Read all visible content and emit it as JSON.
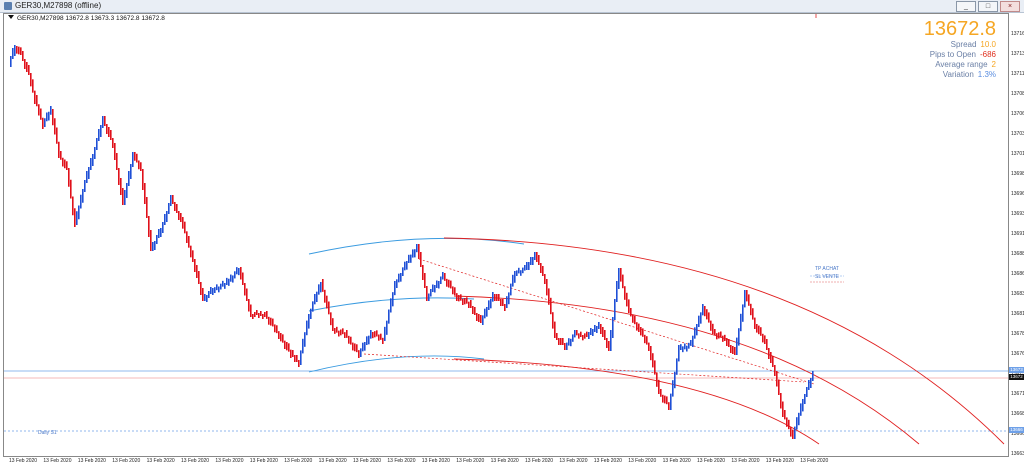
{
  "window": {
    "title": "GER30,M27898 (offline)",
    "buttons": {
      "minimize": "_",
      "maximize": "□",
      "close": "×"
    }
  },
  "chart": {
    "ohlc_header": "GER30,M27898  13672.8 13673.3 13672.8 13672.8"
  },
  "info_panel": {
    "price": "13672.8",
    "price_color": "#f5a623",
    "rows": [
      {
        "label": "Spread",
        "value": "10.0",
        "color": "#f5a623"
      },
      {
        "label": "Pips to Open",
        "value": "-686",
        "color": "#e0301e"
      },
      {
        "label": "Average range",
        "value": "2",
        "color": "#f5a623"
      },
      {
        "label": "Variation",
        "value": "1.3%",
        "color": "#5a8de0"
      }
    ]
  },
  "price_axis": {
    "ticks": [
      "13716",
      "13713",
      "13711",
      "13708",
      "13706",
      "13703",
      "13701",
      "13698",
      "13696",
      "13693",
      "13691",
      "13688",
      "13686",
      "13683",
      "13681",
      "13678",
      "13676",
      "13673",
      "13671",
      "13668",
      "13666",
      "13663"
    ],
    "tags": [
      {
        "value": "13673",
        "color": "#6ea0e8"
      },
      {
        "value": "13672",
        "color": "#111111"
      },
      {
        "value": "13666",
        "color": "#6ea0e8"
      }
    ]
  },
  "time_axis": {
    "labels": [
      "13 Feb 2020",
      "13 Feb 2020",
      "13 Feb 2020",
      "13 Feb 2020",
      "13 Feb 2020",
      "13 Feb 2020",
      "13 Feb 2020",
      "13 Feb 2020",
      "13 Feb 2020",
      "13 Feb 2020",
      "13 Feb 2020",
      "13 Feb 2020",
      "13 Feb 2020",
      "13 Feb 2020",
      "13 Feb 2020",
      "13 Feb 2020",
      "13 Feb 2020",
      "13 Feb 2020",
      "13 Feb 2020",
      "13 Feb 2020",
      "13 Feb 2020",
      "13 Feb 2020",
      "13 Feb 2020",
      "13 Feb 2020"
    ]
  },
  "annotations": {
    "tp_achat": "TP ACHAT",
    "sl_vente": "SL VENTE",
    "daily_s1": "Daily S1"
  },
  "colors": {
    "bull": "#1f4fd6",
    "bear": "#e0101a",
    "channel_blue": "#3a9be0",
    "channel_red": "#e02020"
  }
}
